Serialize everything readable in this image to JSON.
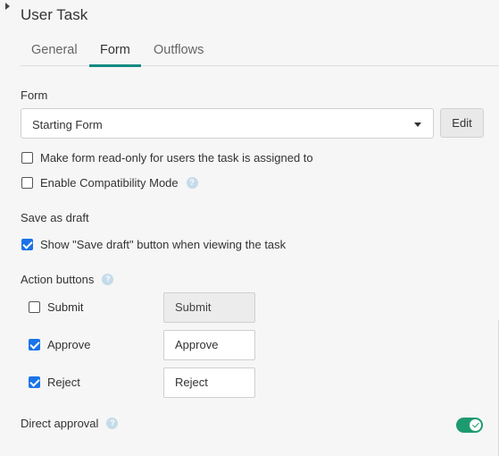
{
  "header": {
    "title": "User Task"
  },
  "tabs": [
    {
      "label": "General",
      "active": false
    },
    {
      "label": "Form",
      "active": true
    },
    {
      "label": "Outflows",
      "active": false
    }
  ],
  "form_section": {
    "label": "Form",
    "select_value": "Starting Form",
    "edit_label": "Edit",
    "readonly_label": "Make form read-only for users the task is assigned to",
    "readonly_checked": false,
    "compat_label": "Enable Compatibility Mode",
    "compat_checked": false
  },
  "draft_section": {
    "label": "Save as draft",
    "show_draft_label": "Show \"Save draft\" button when viewing the task",
    "show_draft_checked": true
  },
  "actions_section": {
    "label": "Action buttons",
    "items": [
      {
        "label": "Submit",
        "checked": false,
        "value": "Submit",
        "disabled": true
      },
      {
        "label": "Approve",
        "checked": true,
        "value": "Approve",
        "disabled": false
      },
      {
        "label": "Reject",
        "checked": true,
        "value": "Reject",
        "disabled": false
      }
    ]
  },
  "direct_approval": {
    "label": "Direct approval",
    "enabled": true
  },
  "colors": {
    "accent": "#128a82",
    "toggle_on": "#1e9a6f",
    "checkbox": "#1a73e8",
    "help_icon": "#c5dbe9"
  }
}
